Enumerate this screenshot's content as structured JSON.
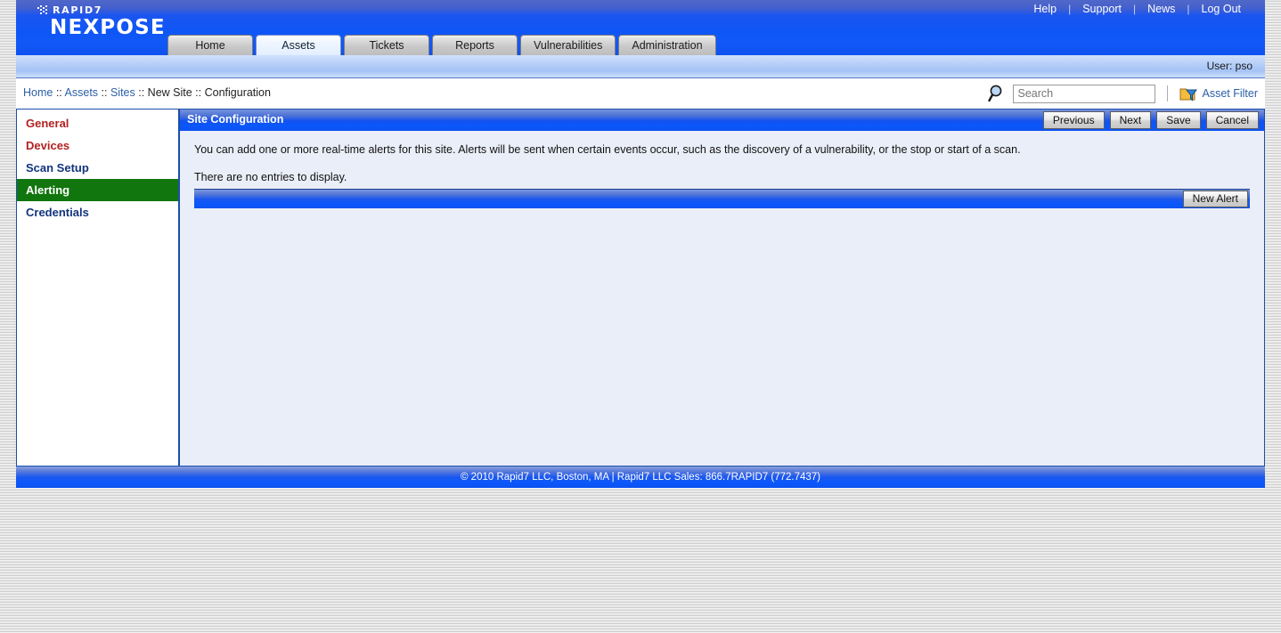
{
  "brand": {
    "company": "RAPID7",
    "product": "NEXPOSE"
  },
  "top_links": [
    {
      "label": "Help"
    },
    {
      "label": "Support"
    },
    {
      "label": "News"
    },
    {
      "label": "Log Out"
    }
  ],
  "separator": "|",
  "tabs": [
    {
      "label": "Home",
      "active": false
    },
    {
      "label": "Assets",
      "active": true
    },
    {
      "label": "Tickets",
      "active": false
    },
    {
      "label": "Reports",
      "active": false
    },
    {
      "label": "Vulnerabilities",
      "active": false
    },
    {
      "label": "Administration",
      "active": false
    }
  ],
  "userbar": {
    "user_text": "User: pso"
  },
  "breadcrumb": {
    "items": [
      {
        "label": "Home",
        "link": true
      },
      {
        "label": "Assets",
        "link": true
      },
      {
        "label": "Sites",
        "link": true
      },
      {
        "label": "New Site",
        "link": false
      },
      {
        "label": "Configuration",
        "link": false
      }
    ],
    "divider": " :: "
  },
  "search": {
    "placeholder": "Search",
    "value": "",
    "icon": "search-icon",
    "asset_filter_label": "Asset Filter",
    "asset_filter_icon": "folder-funnel-icon"
  },
  "sidebar": {
    "items": [
      {
        "label": "General",
        "style": "red",
        "active": false
      },
      {
        "label": "Devices",
        "style": "red",
        "active": false
      },
      {
        "label": "Scan Setup",
        "style": "blue",
        "active": false
      },
      {
        "label": "Alerting",
        "style": "blue",
        "active": true
      },
      {
        "label": "Credentials",
        "style": "blue",
        "active": false
      }
    ]
  },
  "panel": {
    "title": "Site Configuration",
    "buttons": [
      {
        "label": "Previous"
      },
      {
        "label": "Next"
      },
      {
        "label": "Save"
      },
      {
        "label": "Cancel"
      }
    ],
    "intro": "You can add one or more real-time alerts for this site. Alerts will be sent when certain events occur, such as the discovery of a vulnerability, or the stop or start of a scan.",
    "empty_message": "There are no entries to display.",
    "new_alert_label": "New Alert"
  },
  "footer": {
    "text": "© 2010 Rapid7 LLC, Boston, MA | Rapid7 LLC Sales: 866.7RAPID7 (772.7437)"
  },
  "colors": {
    "brand_blue": "#0f56f7",
    "header_gradient_top": "#5068c8",
    "active_nav_green": "#12760e",
    "nav_red": "#b42121",
    "nav_blue": "#12347c",
    "content_bg": "#eaeef8",
    "panel_border": "#1b4ea8"
  }
}
